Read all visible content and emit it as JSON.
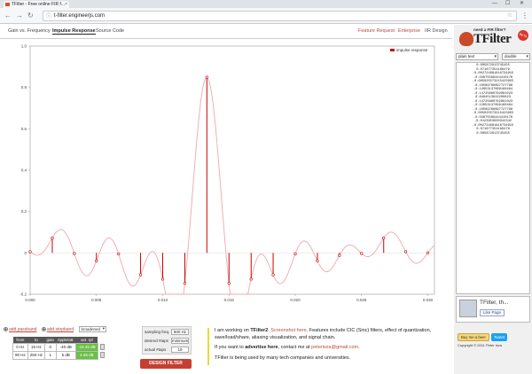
{
  "browser": {
    "tab_title": "TFilter - Free online FIR f...",
    "url": "t-filter.engineerjs.com",
    "window_controls": [
      "—",
      "☐",
      "✕"
    ]
  },
  "nav": {
    "left": [
      "Gain vs. Frequency",
      "Impulse Response",
      "Source Code"
    ],
    "active_index": 1,
    "right": [
      "Feature Request",
      "Enterprise",
      "IIR Design"
    ]
  },
  "chart_data": {
    "type": "scatter",
    "subtype": "stem",
    "legend": [
      "impulse response"
    ],
    "legend_position": "top-right",
    "colors": {
      "stem": "#cc0000",
      "curve": "#f0a7ae",
      "marker": "#cc0000"
    },
    "xlim": [
      0,
      0.0305
    ],
    "ylim": [
      -0.2,
      1.0
    ],
    "x_ticks": [
      "0.000",
      "0.005",
      "0.010",
      "0.015",
      "0.020",
      "0.025",
      "0.030"
    ],
    "y_ticks": [
      "-0.2",
      "0",
      "0.2",
      "0.4",
      "0.6",
      "0.8",
      "1.0"
    ],
    "grid": false,
    "x_stems": [
      0.0,
      0.00167,
      0.00333,
      0.005,
      0.00667,
      0.00833,
      0.01,
      0.01167,
      0.01333,
      0.015,
      0.01667,
      0.01833,
      0.02,
      0.02167,
      0.02333,
      0.025,
      0.02667,
      0.02833,
      0.03
    ],
    "values": [
      0.005872913745,
      0.071677354186,
      -0.002724681616,
      -0.038755894444,
      -0.005025573215,
      -0.105897866977,
      -0.126531370991,
      -0.147258607629,
      0.84945136222,
      -0.147258607629,
      -0.126531370991,
      -0.105897866977,
      -0.005025573215,
      -0.038755894444,
      -0.012395363034,
      -0.002724681616,
      0.071677354186,
      0.005872913745,
      0.0
    ]
  },
  "sidebar": {
    "logo_tag": "need a FIR filter?",
    "logo_word": "TFilter",
    "logo_badge": "BETA",
    "select_format": "plain text",
    "select_precision": "double",
    "coefficients": [
      "0.005872913745455",
      "0.071677354186479",
      "-0.002724681616734915",
      "-0.03875589444410176",
      "-0.005025573215423955",
      "-0.10589786697727796",
      "-0.12653137099160464",
      "-0.14725860762961023",
      "0.8494513622200823",
      "-0.14725860762961023",
      "-0.12653137099160464",
      "-0.10589786697727796",
      "-0.005025573215423955",
      "-0.03875589444410176",
      "-0.0123953630342342",
      "-0.002724681616734915",
      "0.071677354186479",
      "0.005872913745455"
    ],
    "ad_title": "TFilter, th...",
    "fb_like": "Like Page",
    "buy_btn": "Buy me a beer",
    "tweet_btn": "Tweet",
    "copyright": "Copyright © 2011 Peter Isza"
  },
  "bottom": {
    "radio_passband": "add passband",
    "radio_stopband": "add stopband",
    "window_select": "broadened",
    "table_headers": [
      "from",
      "to",
      "gain",
      "ripple/att.",
      "act. rpl"
    ],
    "table_rows": [
      [
        "0 Hz",
        "15 Hz",
        "0",
        "-40 dB",
        "-44.45 dB"
      ],
      [
        "90 Hz",
        "250 Hz",
        "1",
        "5 dB",
        "2.46 dB"
      ]
    ],
    "params": [
      {
        "label": "sampling freq.",
        "value": "500 Hz"
      },
      {
        "label": "desired #taps",
        "value": "minimum"
      },
      {
        "label": "actual #taps",
        "value": "19"
      }
    ],
    "design_btn": "DESIGN FILTER",
    "msg1_a": "I am working on ",
    "msg1_b": "TFilter2",
    "msg1_c": ". ",
    "msg1_link": "Screenshot here",
    "msg1_d": ". Features include CIC (Sinc) filters, effect of quantization, save/load/share, aliasing visualization, and signal chain.",
    "msg2_a": "If you want to ",
    "msg2_b": "advertise here",
    "msg2_c": ", contact me at ",
    "msg2_email": "peterisza@gmail.com",
    "msg2_d": ".",
    "msg3": "TFilter is being used by many tech companies and universities."
  }
}
